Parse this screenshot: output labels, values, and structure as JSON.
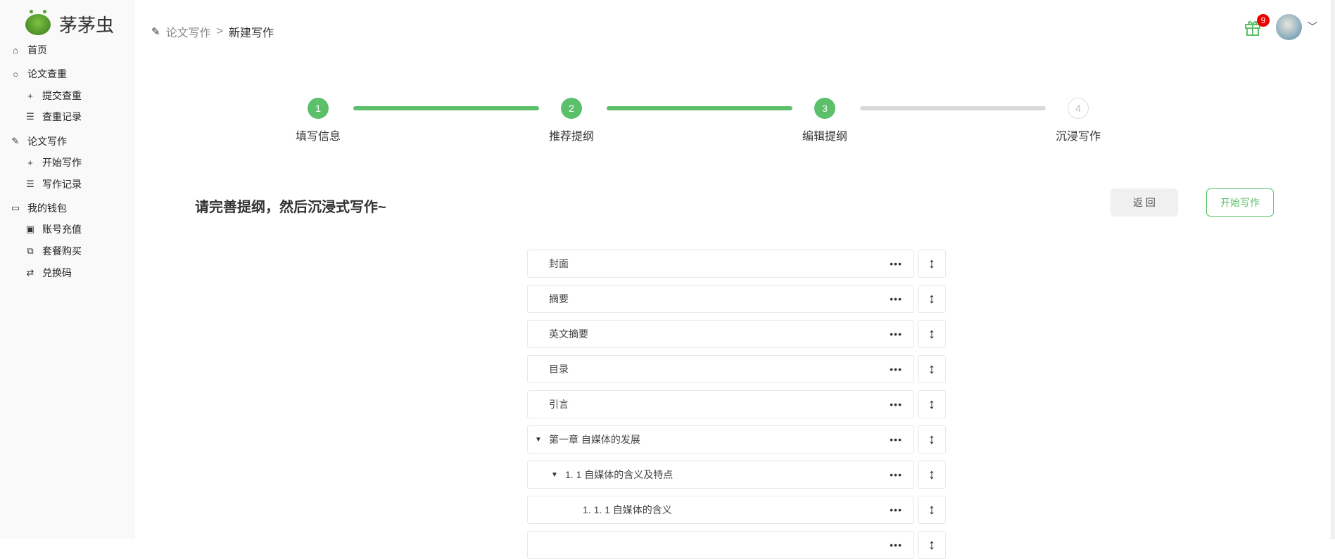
{
  "app": {
    "name": "茅茅虫"
  },
  "sidebar": {
    "items": [
      {
        "label": "首页",
        "icon": "home-icon",
        "level": 0
      },
      {
        "label": "论文查重",
        "icon": "search-icon",
        "level": 0
      },
      {
        "label": "提交查重",
        "icon": "plus-icon",
        "level": 1
      },
      {
        "label": "查重记录",
        "icon": "list-icon",
        "level": 1
      },
      {
        "label": "论文写作",
        "icon": "pencil-icon",
        "level": 0
      },
      {
        "label": "开始写作",
        "icon": "plus-icon",
        "level": 1
      },
      {
        "label": "写作记录",
        "icon": "list-icon",
        "level": 1
      },
      {
        "label": "我的钱包",
        "icon": "wallet-icon",
        "level": 0
      },
      {
        "label": "账号充值",
        "icon": "recharge-icon",
        "level": 1
      },
      {
        "label": "套餐购买",
        "icon": "package-icon",
        "level": 1
      },
      {
        "label": "兑换码",
        "icon": "exchange-icon",
        "level": 1
      }
    ]
  },
  "header": {
    "breadcrumb": [
      "论文写作",
      "新建写作"
    ],
    "separator": ">",
    "gift_badge": "9"
  },
  "steps": [
    {
      "num": "1",
      "label": "填写信息",
      "status": "done"
    },
    {
      "num": "2",
      "label": "推荐提纲",
      "status": "done"
    },
    {
      "num": "3",
      "label": "编辑提纲",
      "status": "current"
    },
    {
      "num": "4",
      "label": "沉浸写作",
      "status": "todo"
    }
  ],
  "main": {
    "title": "请完善提纲，然后沉浸式写作~",
    "back_label": "返 回",
    "start_label": "开始写作"
  },
  "outline": [
    {
      "label": "封面",
      "level": 0,
      "expandable": false
    },
    {
      "label": "摘要",
      "level": 0,
      "expandable": false
    },
    {
      "label": "英文摘要",
      "level": 0,
      "expandable": false
    },
    {
      "label": "目录",
      "level": 0,
      "expandable": false
    },
    {
      "label": "引言",
      "level": 0,
      "expandable": false
    },
    {
      "label": "第一章 自媒体的发展",
      "level": 0,
      "expandable": true
    },
    {
      "label": "1. 1 自媒体的含义及特点",
      "level": 1,
      "expandable": true
    },
    {
      "label": "1. 1. 1 自媒体的含义",
      "level": 2,
      "expandable": false
    },
    {
      "label": "",
      "level": 2,
      "expandable": false
    }
  ],
  "colors": {
    "accent": "#5cc06a",
    "inactive": "#d9d9d9",
    "badge": "#e00000"
  }
}
